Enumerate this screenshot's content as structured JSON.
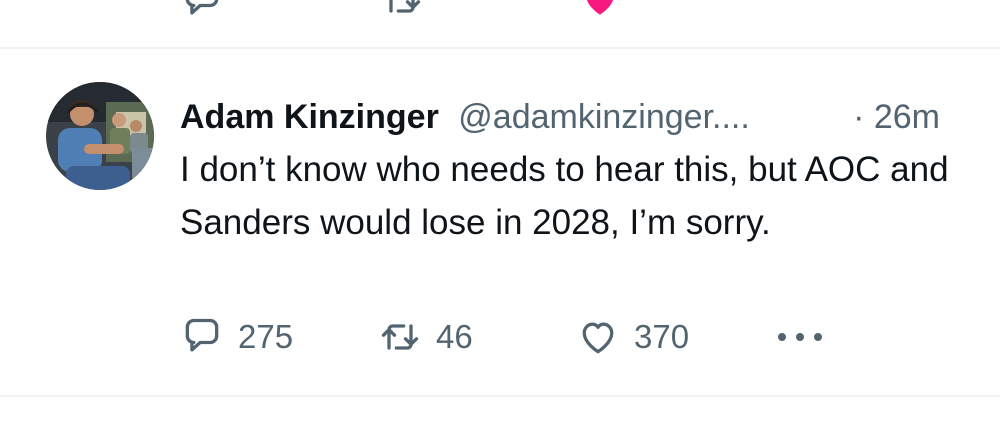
{
  "tweet": {
    "display_name": "Adam Kinzinger",
    "handle": "@adamkinzinger....",
    "timestamp": "· 26m",
    "text": "I don’t know who needs to hear this, but AOC and Sanders would lose in 2028, I’m sorry.",
    "avatar_icon": "profile-photo",
    "actions": {
      "reply_count": "275",
      "retweet_count": "46",
      "like_count": "370",
      "more_icon": "more-horizontal-icon"
    }
  },
  "colors": {
    "text_primary": "#0f1419",
    "text_secondary": "#536471",
    "divider": "#eff3f4",
    "like_pink": "#f91880"
  }
}
